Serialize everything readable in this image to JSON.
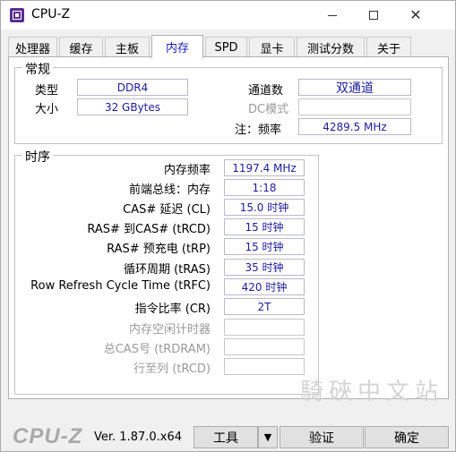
{
  "window": {
    "title": "CPU-Z",
    "icons": {
      "app": "cpu-z-app-icon",
      "minimize": "minimize-icon",
      "maximize": "maximize-icon",
      "close": "close-icon"
    },
    "close_glyph": "✕"
  },
  "tabs": [
    {
      "label": "处理器",
      "active": false
    },
    {
      "label": "缓存",
      "active": false
    },
    {
      "label": "主板",
      "active": false
    },
    {
      "label": "内存",
      "active": true
    },
    {
      "label": "SPD",
      "active": false
    },
    {
      "label": "显卡",
      "active": false
    },
    {
      "label": "测试分数",
      "active": false
    },
    {
      "label": "关于",
      "active": false
    }
  ],
  "general": {
    "title": "常规",
    "type_label": "类型",
    "type_value": "DDR4",
    "size_label": "大小",
    "size_value": "32 GBytes",
    "channels_label": "通道数",
    "channels_value": "双通道",
    "dc_mode_label": "DC模式",
    "dc_mode_value": "",
    "note_label": "注：频率",
    "note_value": "4289.5 MHz"
  },
  "timing": {
    "title": "时序",
    "rows": [
      {
        "label": "内存频率",
        "value": "1197.4 MHz",
        "enabled": true
      },
      {
        "label": "前端总线：内存",
        "value": "1:18",
        "enabled": true
      },
      {
        "label": "CAS# 延迟 (CL)",
        "value": "15.0 时钟",
        "enabled": true
      },
      {
        "label": "RAS# 到CAS# (tRCD)",
        "value": "15 时钟",
        "enabled": true
      },
      {
        "label": "RAS# 预充电 (tRP)",
        "value": "15 时钟",
        "enabled": true
      },
      {
        "label": "循环周期 (tRAS)",
        "value": "35 时钟",
        "enabled": true
      },
      {
        "label": "Row Refresh Cycle Time (tRFC)",
        "value": "420 时钟",
        "enabled": true
      },
      {
        "label": "指令比率 (CR)",
        "value": "2T",
        "enabled": true
      },
      {
        "label": "内存空闲计时器",
        "value": "",
        "enabled": false
      },
      {
        "label": "总CAS号 (tRDRAM)",
        "value": "",
        "enabled": false
      },
      {
        "label": "行至列 (tRCD)",
        "value": "",
        "enabled": false
      }
    ]
  },
  "watermark": "騎硤中文站",
  "footer": {
    "logo": "CPU-Z",
    "version": "Ver. 1.87.0.x64",
    "tools_label": "工具",
    "tools_dropdown_glyph": "▼",
    "verify_label": "验证",
    "ok_label": "确定"
  }
}
